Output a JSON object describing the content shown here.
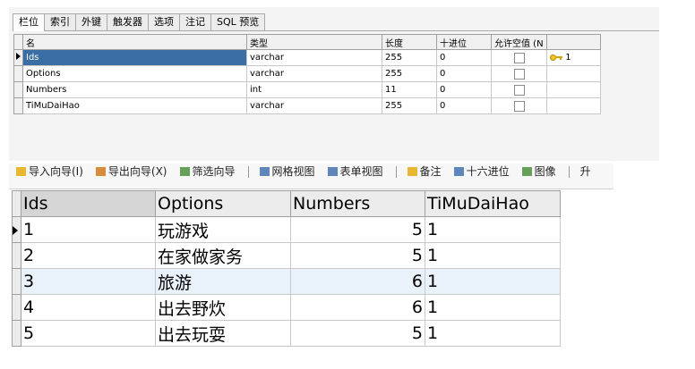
{
  "designer": {
    "tabs": [
      "栏位",
      "索引",
      "外键",
      "触发器",
      "选项",
      "注记",
      "SQL 预览"
    ],
    "active_tab": "栏位",
    "columns": [
      "名",
      "类型",
      "长度",
      "十进位",
      "允许空值 (N",
      ""
    ],
    "fields": [
      {
        "name": "Ids",
        "type": "varchar",
        "length": "255",
        "decimals": "0",
        "allow_null": false,
        "key": "1"
      },
      {
        "name": "Options",
        "type": "varchar",
        "length": "255",
        "decimals": "0",
        "allow_null": false,
        "key": ""
      },
      {
        "name": "Numbers",
        "type": "int",
        "length": "11",
        "decimals": "0",
        "allow_null": false,
        "key": ""
      },
      {
        "name": "TiMuDaiHao",
        "type": "varchar",
        "length": "255",
        "decimals": "0",
        "allow_null": false,
        "key": ""
      }
    ]
  },
  "toolbar": {
    "items": [
      "导入向导(I)",
      "导出向导(X)",
      "筛选向导",
      "网格视图",
      "表单视图",
      "备注",
      "十六进位",
      "图像",
      "升"
    ]
  },
  "grid": {
    "columns": [
      "Ids",
      "Options",
      "Numbers",
      "TiMuDaiHao"
    ],
    "rows": [
      {
        "Ids": "1",
        "Options": "玩游戏",
        "Numbers": "5",
        "TiMuDaiHao": "1"
      },
      {
        "Ids": "2",
        "Options": "在家做家务",
        "Numbers": "5",
        "TiMuDaiHao": "1"
      },
      {
        "Ids": "3",
        "Options": "旅游",
        "Numbers": "6",
        "TiMuDaiHao": "1"
      },
      {
        "Ids": "4",
        "Options": "出去野炊",
        "Numbers": "6",
        "TiMuDaiHao": "1"
      },
      {
        "Ids": "5",
        "Options": "出去玩耍",
        "Numbers": "5",
        "TiMuDaiHao": "1"
      }
    ]
  },
  "colors": {
    "selection": "#3a6ea5",
    "alt_row": "#e9f1fb",
    "key_icon": "#f3c623"
  }
}
